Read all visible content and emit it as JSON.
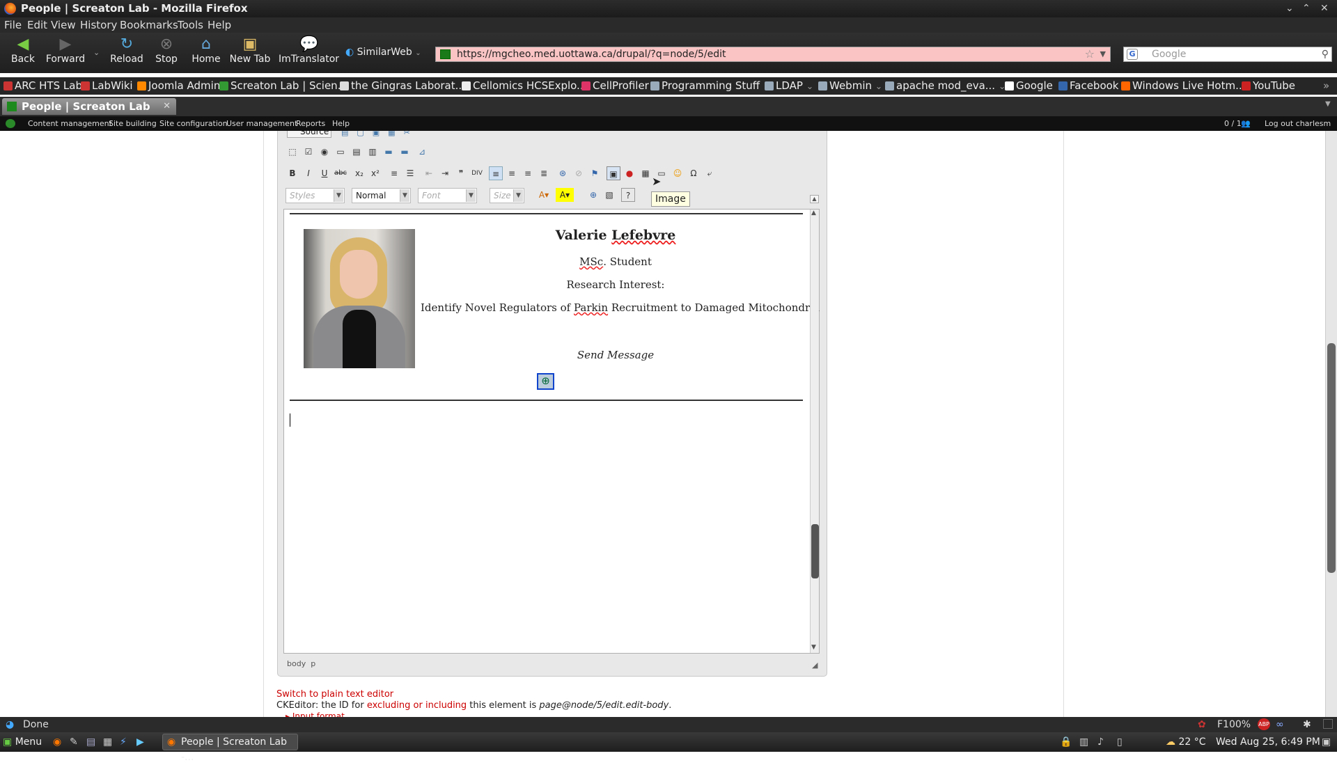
{
  "window": {
    "title": "People | Screaton Lab - Mozilla Firefox"
  },
  "menubar": [
    "File",
    "Edit",
    "View",
    "History",
    "Bookmarks",
    "Tools",
    "Help"
  ],
  "nav": {
    "back": "Back",
    "forward": "Forward",
    "reload": "Reload",
    "stop": "Stop",
    "home": "Home",
    "newtab": "New Tab",
    "imtranslator": "ImTranslator",
    "similarweb": "SimilarWeb"
  },
  "url": "https://mgcheo.med.uottawa.ca/drupal/?q=node/5/edit",
  "search": {
    "placeholder": "Google"
  },
  "bookmarks": [
    "ARC HTS Lab",
    "LabWiki",
    "Joomla Admin",
    "Screaton Lab | Scien...",
    "the Gingras Laborat...",
    "Cellomics HCSExplo...",
    "CellProfiler",
    "Programming Stuff",
    "LDAP",
    "Webmin",
    "apache mod_eva...",
    "Google",
    "Facebook",
    "Windows Live Hotm...",
    "YouTube"
  ],
  "tab": {
    "title": "People | Screaton Lab"
  },
  "admin": {
    "items": [
      "Content management",
      "Site building",
      "Site configuration",
      "User management",
      "Reports",
      "Help"
    ],
    "users": "0 / 1",
    "logout": "Log out charlesm"
  },
  "editor": {
    "source_label": "Source",
    "format_value": "Normal",
    "styles_placeholder": "Styles",
    "font_placeholder": "Font",
    "size_placeholder": "Size",
    "tooltip": "Image",
    "content": {
      "name_first": "Valerie",
      "name_last": "Lefebvre",
      "degree_a": "MSc",
      "degree_b": ". Student",
      "interest_label": "Research Interest:",
      "interest_a": "Identify Novel Regulators of ",
      "interest_b": "Parkin",
      "interest_c": " Recruitment to Damaged Mitochondria",
      "send": "Send Message"
    },
    "path": {
      "body": "body",
      "p": "p"
    }
  },
  "below": {
    "switch": "Switch to plain text editor",
    "ck_a": "CKEditor: the ID for ",
    "ck_b": "excluding or including",
    "ck_c": " this element is ",
    "ck_d": "page@node/5/edit.edit-body",
    "ck_e": ".",
    "input_format": "Input format"
  },
  "statusbar": {
    "text": "Done",
    "zoom": "F100%"
  },
  "taskbar": {
    "menu": "Menu",
    "task": "People | Screaton Lab -...",
    "weather": "22 °C",
    "clock": "Wed Aug 25,  6:49 PM"
  }
}
